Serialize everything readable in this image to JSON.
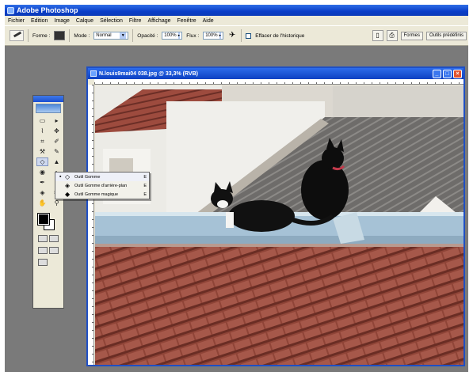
{
  "app": {
    "title": "Adobe Photoshop"
  },
  "menu": [
    "Fichier",
    "Edition",
    "Image",
    "Calque",
    "Sélection",
    "Filtre",
    "Affichage",
    "Fenêtre",
    "Aide"
  ],
  "options": {
    "brush_label": "Forme :",
    "mode_label": "Mode :",
    "mode_value": "Normal",
    "opacity_label": "Opacité :",
    "opacity_value": "100%",
    "flow_label": "Flux :",
    "flow_value": "100%",
    "history_label": "Effacer de l'historique",
    "palette_tabs": [
      "Formes",
      "Outils prédéfinis"
    ]
  },
  "toolbox": {
    "tools": [
      "▭",
      "▸",
      "⌇",
      "✥",
      "⌗",
      "✐",
      "⚒",
      "✎",
      "▲",
      "⚲",
      "◉",
      "◐",
      "✒",
      "T",
      "◈",
      "✂",
      "✋",
      "🔍"
    ],
    "foreground": "#000000",
    "background": "#ffffff"
  },
  "flyout": {
    "items": [
      {
        "label": "Outil Gomme",
        "key": "E",
        "active": true,
        "icon": "eraser-icon"
      },
      {
        "label": "Outil Gomme d'arrière-plan",
        "key": "E",
        "active": false,
        "icon": "background-eraser-icon"
      },
      {
        "label": "Outil Gomme magique",
        "key": "E",
        "active": false,
        "icon": "magic-eraser-icon"
      }
    ]
  },
  "document": {
    "title": "N.louis9mai04 038.jpg @ 33,3% (RVB)",
    "buttons": [
      "_",
      "□",
      "×"
    ]
  },
  "colors": {
    "xp_blue": "#0a3ec8",
    "chrome": "#ece9d8",
    "workspace": "#7a7a7a",
    "roof_tile": "#9a4a3c"
  }
}
